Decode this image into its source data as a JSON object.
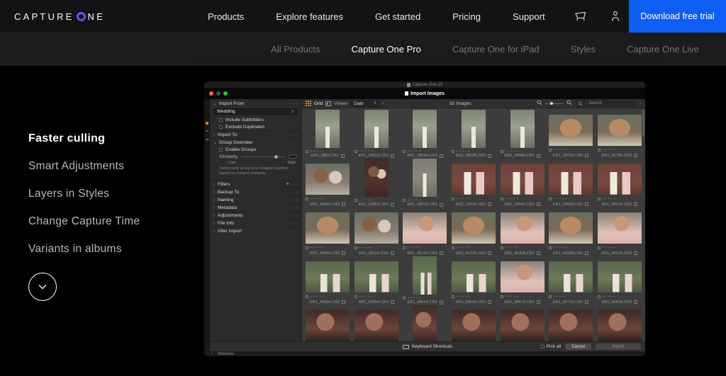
{
  "colors": {
    "accent_blue": "#0d5ef4",
    "grid_icon_orange": "#e0862e",
    "traffic_red": "#ff5f57",
    "traffic_green": "#28c840"
  },
  "header": {
    "logo_prefix": "CAPTURE",
    "logo_suffix": "NE",
    "nav": [
      "Products",
      "Explore features",
      "Get started",
      "Pricing",
      "Support"
    ],
    "cta": "Download free trial"
  },
  "subnav": [
    {
      "label": "All Products",
      "active": false
    },
    {
      "label": "Capture One Pro",
      "active": true
    },
    {
      "label": "Capture One for iPad",
      "active": false
    },
    {
      "label": "Styles",
      "active": false
    },
    {
      "label": "Capture One Live",
      "active": false
    }
  ],
  "features": [
    {
      "label": "Faster culling",
      "active": true
    },
    {
      "label": "Smart Adjustments",
      "active": false
    },
    {
      "label": "Layers in Styles",
      "active": false
    },
    {
      "label": "Change Capture Time",
      "active": false
    },
    {
      "label": "Variants in albums",
      "active": false
    }
  ],
  "app": {
    "window_title": "Capture One 23",
    "dialog_title": "Import Images",
    "toolbar": {
      "grid_label": "Grid",
      "viewer_label": "Viewer",
      "sort_value": "Date",
      "image_count": "92 Images",
      "search_placeholder": "Search"
    },
    "panel": {
      "import_from": {
        "title": "Import From",
        "source": "Wedding",
        "options": [
          "Include Subfolders",
          "Exclude Duplicates"
        ]
      },
      "import_to": {
        "title": "Import To"
      },
      "group_overview": {
        "title": "Group Overview",
        "enable": "Enable Groups",
        "similarity_label": "Similarity",
        "low": "Low",
        "high": "High",
        "caption": "Temporarily group your images together based on content similarity."
      },
      "collapsed_sections": [
        {
          "title": "Filters",
          "plus": true
        },
        {
          "title": "Backup To",
          "plus": false
        },
        {
          "title": "Naming",
          "plus": false
        },
        {
          "title": "Metadata",
          "plus": false
        },
        {
          "title": "Adjustments",
          "plus": false
        },
        {
          "title": "File Info",
          "plus": false
        },
        {
          "title": "After Import",
          "plus": false
        }
      ]
    },
    "footer": {
      "shortcuts": "Keyboard Shortcuts",
      "pick_all": "Pick all",
      "cancel": "Cancel",
      "import": "Import"
    },
    "status": "Metadata",
    "grid_rows": [
      {
        "cells": [
          {
            "file": "ER1_3863.CR3",
            "o": "p",
            "k": "street"
          },
          {
            "file": "ER1_3860A.CR3",
            "o": "p",
            "k": "street"
          },
          {
            "file": "ER1_3862A.CR3",
            "o": "p",
            "k": "street"
          },
          {
            "file": "ER1_3863B.CR3",
            "o": "p",
            "k": "street"
          },
          {
            "file": "ER1_3868A.CR3",
            "o": "p",
            "k": "street"
          },
          {
            "file": "ER1_3973A.CR3",
            "o": "l",
            "k": "face"
          },
          {
            "file": "ER1_3979A.CR3",
            "o": "l",
            "k": "face"
          }
        ]
      },
      {
        "cells": [
          {
            "file": "ER1_3982A.CR3",
            "o": "l",
            "k": "couple"
          },
          {
            "file": "ER1_3986A.CR3",
            "o": "p",
            "k": "brickp"
          },
          {
            "file": "ER1_3987A.CR3",
            "o": "p",
            "k": "bride"
          },
          {
            "file": "ER1_3993A.CR3",
            "o": "l",
            "k": "brick"
          },
          {
            "file": "ER1_3994A.CR3",
            "o": "l",
            "k": "brick"
          },
          {
            "file": "ER1_3996A.CR3",
            "o": "l",
            "k": "brick"
          },
          {
            "file": "ER1_4001A.CR3",
            "o": "l",
            "k": "brick"
          }
        ]
      },
      {
        "cells": [
          {
            "file": "ER1_4008A.CR3",
            "o": "l",
            "k": "face"
          },
          {
            "file": "ER1_4011A.CR3",
            "o": "l",
            "k": "couple"
          },
          {
            "file": "ER1_4012A.CR3",
            "o": "l",
            "k": "blush"
          },
          {
            "file": "ER1_4022A.CR3",
            "o": "l",
            "k": "face"
          },
          {
            "file": "ER1_4030A.CR3",
            "o": "l",
            "k": "blush"
          },
          {
            "file": "ER1_4033A.CR3",
            "o": "l",
            "k": "face"
          },
          {
            "file": "ER1_4052A.CR3",
            "o": "l",
            "k": "blush"
          }
        ]
      },
      {
        "cells": [
          {
            "file": "ER1_4058A.CR3",
            "o": "l",
            "k": "green"
          },
          {
            "file": "ER1_4060A.CR3",
            "o": "l",
            "k": "green"
          },
          {
            "file": "ER1_4061A.CR3",
            "o": "p",
            "k": "green"
          },
          {
            "file": "ER1_4063A.CR3",
            "o": "l",
            "k": "green"
          },
          {
            "file": "ER1_4067A.CR3",
            "o": "l",
            "k": "blush"
          },
          {
            "file": "ER1_4071A.CR3",
            "o": "l",
            "k": "green"
          },
          {
            "file": "ER1_4083A.CR3",
            "o": "l",
            "k": "green"
          }
        ]
      },
      {
        "cells": [
          {
            "file": "",
            "o": "l",
            "k": "dark"
          },
          {
            "file": "",
            "o": "l",
            "k": "dark"
          },
          {
            "file": "",
            "o": "p",
            "k": "dark"
          },
          {
            "file": "",
            "o": "l",
            "k": "dark"
          },
          {
            "file": "",
            "o": "l",
            "k": "dark"
          },
          {
            "file": "",
            "o": "l",
            "k": "dark"
          },
          {
            "file": "",
            "o": "l",
            "k": "dark"
          }
        ]
      }
    ]
  }
}
